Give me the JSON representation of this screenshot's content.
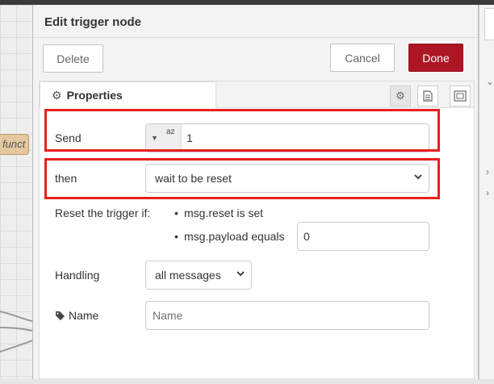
{
  "workspace": {
    "node_label": "funct"
  },
  "dialog": {
    "title": "Edit trigger node",
    "delete_label": "Delete",
    "cancel_label": "Cancel",
    "done_label": "Done",
    "tab_properties": "Properties",
    "send": {
      "label": "Send",
      "type_icon": "az",
      "value": "1"
    },
    "then": {
      "label": "then",
      "selected": "wait to be reset"
    },
    "reset": {
      "label": "Reset the trigger if:",
      "option1": "msg.reset is set",
      "option2_label": "msg.payload equals",
      "option2_value": "0"
    },
    "handling": {
      "label": "Handling",
      "selected": "all messages"
    },
    "name": {
      "label": "Name",
      "placeholder": "Name"
    }
  },
  "colors": {
    "done": "#ad1625",
    "highlight": "#e8201d"
  },
  "icons": [
    "gear-icon",
    "description-icon",
    "appearance-icon",
    "tag-icon",
    "chevron-down-icon",
    "caret-down-icon"
  ]
}
